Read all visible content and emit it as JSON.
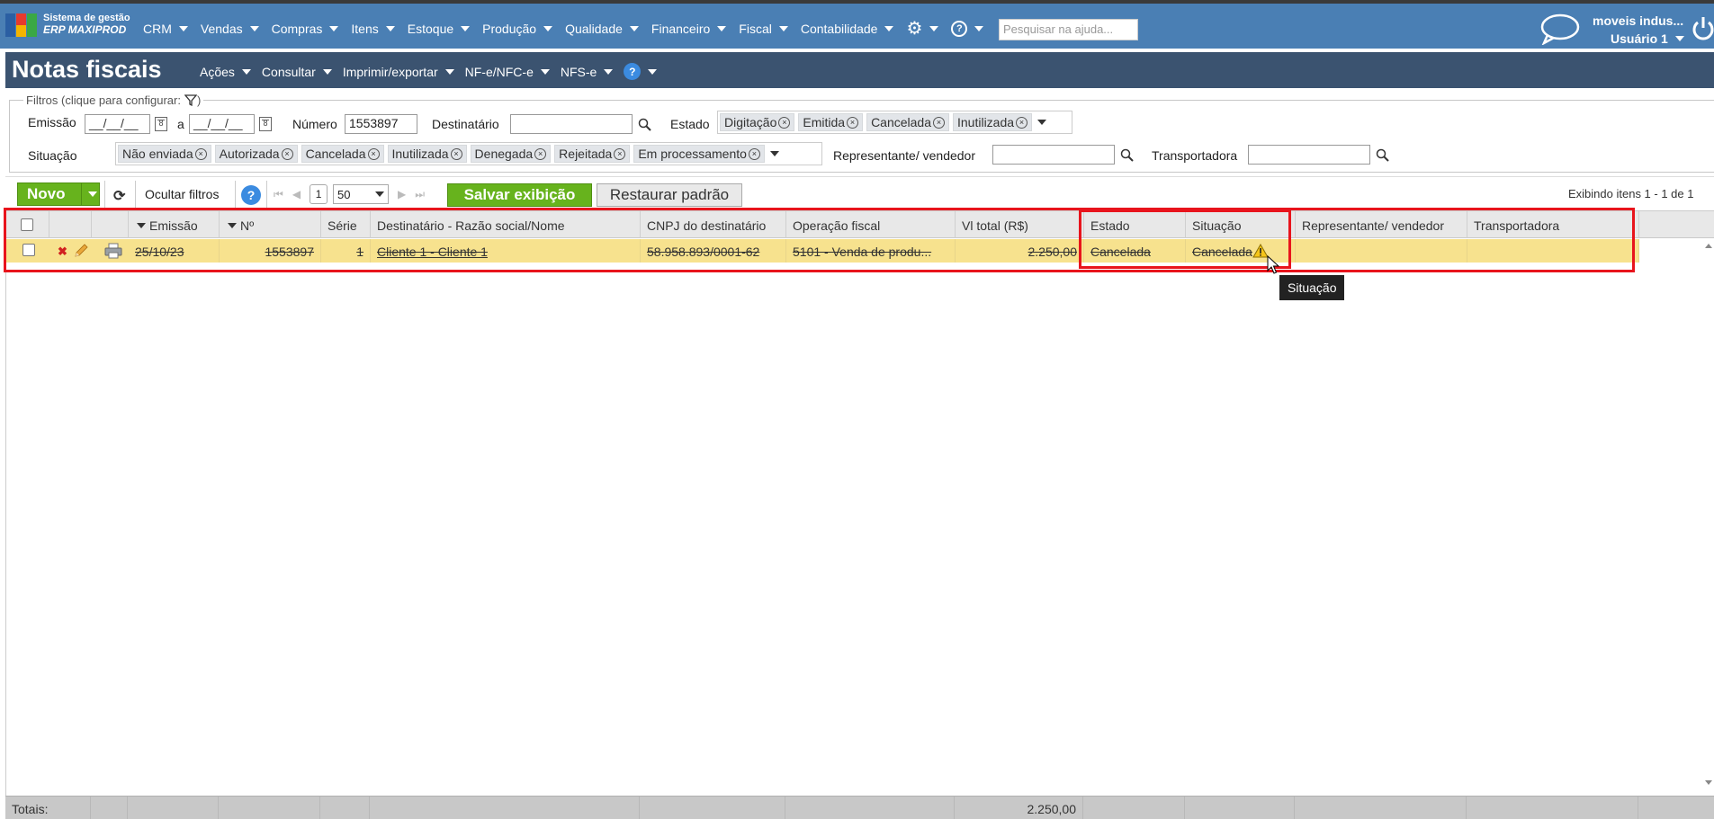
{
  "app": {
    "logo_line1": "Sistema de gestão",
    "logo_line2": "ERP MAXIPROD",
    "nav": [
      "CRM",
      "Vendas",
      "Compras",
      "Itens",
      "Estoque",
      "Produção",
      "Qualidade",
      "Financeiro",
      "Fiscal",
      "Contabilidade"
    ],
    "help_search_placeholder": "Pesquisar na ajuda...",
    "company": "moveis indus...",
    "user": "Usuário 1"
  },
  "page": {
    "title": "Notas fiscais",
    "menu": [
      "Ações",
      "Consultar",
      "Imprimir/exportar",
      "NF-e/NFC-e",
      "NFS-e"
    ]
  },
  "filters": {
    "legend": "Filtros (clique para configurar:",
    "legend_close": ")",
    "emissao_label": "Emissão",
    "date_from": "__/__/__",
    "a_label": "a",
    "date_to": "__/__/__",
    "numero_label": "Número",
    "numero_value": "1553897",
    "destinatario_label": "Destinatário",
    "destinatario_value": "",
    "estado_label": "Estado",
    "estado_tags": [
      "Digitação",
      "Emitida",
      "Cancelada",
      "Inutilizada"
    ],
    "situacao_label": "Situação",
    "situacao_tags": [
      "Não enviada",
      "Autorizada",
      "Cancelada",
      "Inutilizada",
      "Denegada",
      "Rejeitada",
      "Em processamento"
    ],
    "representante_label": "Representante/ vendedor",
    "representante_value": "",
    "transportadora_label": "Transportadora",
    "transportadora_value": ""
  },
  "toolbar": {
    "novo_label": "Novo",
    "ocultar_label": "Ocultar filtros",
    "page_number": "1",
    "page_size": "50",
    "salvar_label": "Salvar exibição",
    "restaurar_label": "Restaurar padrão",
    "exibindo": "Exibindo itens 1 - 1 de 1"
  },
  "grid": {
    "columns": [
      "Emissão",
      "Nº",
      "Série",
      "Destinatário - Razão social/Nome",
      "CNPJ do destinatário",
      "Operação fiscal",
      "Vl total (R$)",
      "Estado",
      "Situação",
      "Representante/ vendedor",
      "Transportadora"
    ],
    "rows": [
      {
        "emissao": "25/10/23",
        "numero": "1553897",
        "serie": "1",
        "destinatario": "Cliente 1 - Cliente 1",
        "cnpj": "58.958.893/0001-62",
        "operacao": "5101 - Venda de produ...",
        "total": "2.250,00",
        "estado": "Cancelada",
        "situacao": "Cancelada",
        "representante": "",
        "transportadora": ""
      }
    ],
    "totals_label": "Totais:",
    "totals_value": "2.250,00"
  },
  "tooltip": "Situação",
  "colors": {
    "topbar": "#4a7fb4",
    "titlebar": "#3b5370",
    "green_button": "#67b31d",
    "row_highlight": "#f7e28e",
    "annotation_red": "#e8141c"
  }
}
